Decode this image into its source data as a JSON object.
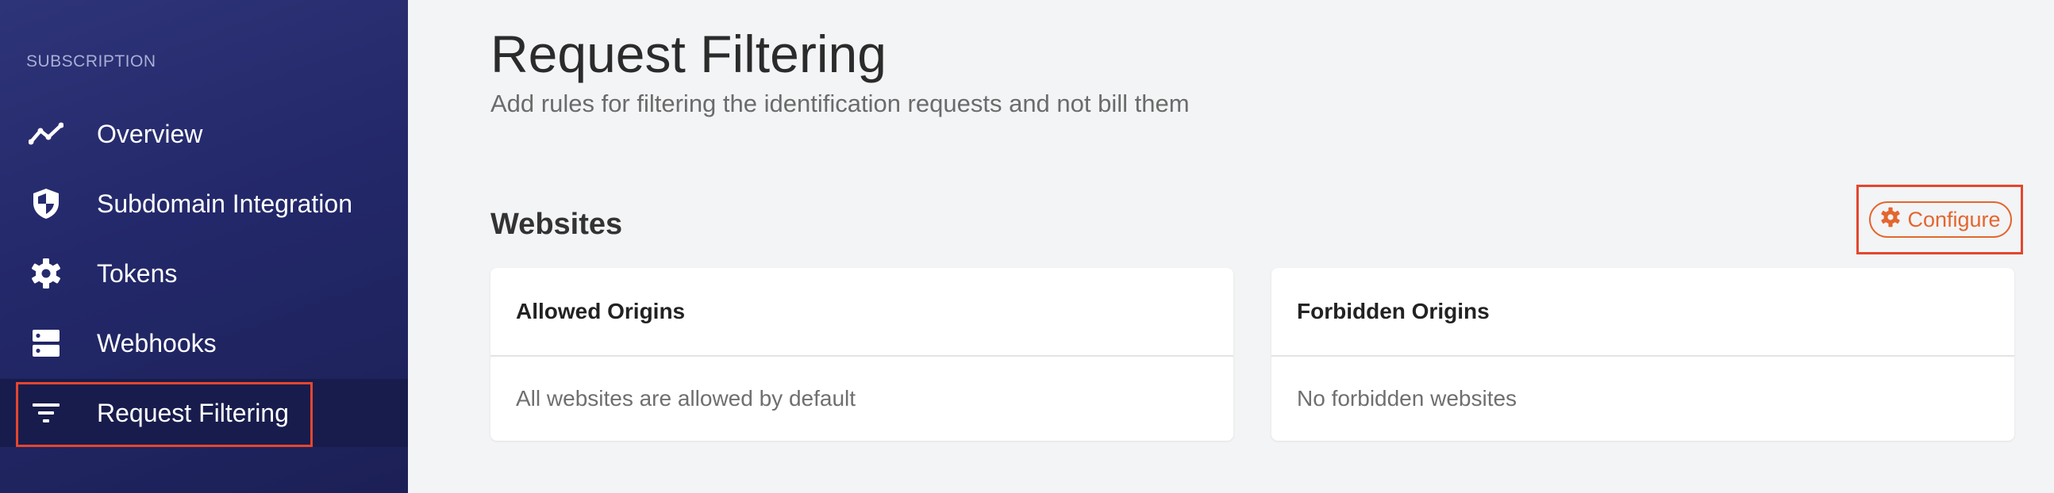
{
  "sidebar": {
    "section_label": "SUBSCRIPTION",
    "items": [
      {
        "label": "Overview",
        "icon": "chart-line-icon"
      },
      {
        "label": "Subdomain Integration",
        "icon": "shield-icon"
      },
      {
        "label": "Tokens",
        "icon": "gear-icon"
      },
      {
        "label": "Webhooks",
        "icon": "server-icon"
      },
      {
        "label": "Request Filtering",
        "icon": "filter-icon",
        "active": true
      }
    ]
  },
  "header": {
    "title": "Request Filtering",
    "subtitle": "Add rules for filtering the identification requests and not bill them"
  },
  "websites": {
    "title": "Websites",
    "configure_label": "Configure",
    "cards": [
      {
        "title": "Allowed Origins",
        "body": "All websites are allowed by default"
      },
      {
        "title": "Forbidden Origins",
        "body": "No forbidden websites"
      }
    ]
  },
  "colors": {
    "sidebar_bg": "#262b6e",
    "accent": "#e4662f",
    "highlight": "#e4462f"
  }
}
